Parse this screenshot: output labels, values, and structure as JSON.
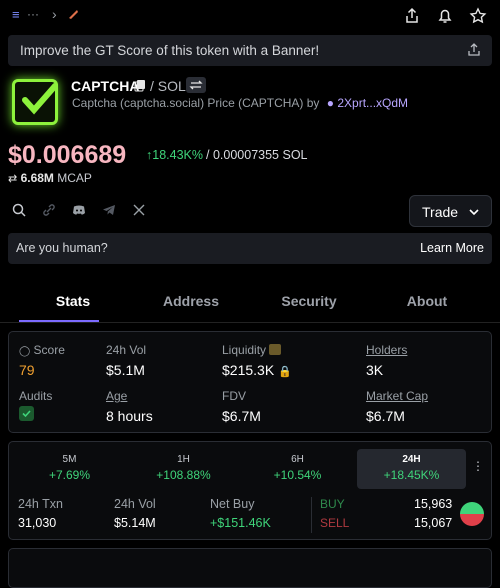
{
  "topbar": {
    "menu_glyph": "≡",
    "more_glyph": "···",
    "chevron_glyph": "›"
  },
  "banner": {
    "text": "Improve the GT Score of this token with a Banner!"
  },
  "token": {
    "name": "CAPTCHA",
    "pair": "/ SOL",
    "subtitle": "Captcha (captcha.social) Price (CAPTCHA) by",
    "creator": "2Xprt...xQdM"
  },
  "price": {
    "usd": "$0.006689",
    "change": "18.43K%",
    "sol_sep": "/",
    "sol": "0.00007355 SOL",
    "mcap_value": "6.68M",
    "mcap_label": "MCAP"
  },
  "trade_button": {
    "label": "Trade"
  },
  "human": {
    "question": "Are you human?",
    "learn_more": "Learn More"
  },
  "tabs": [
    "Stats",
    "Address",
    "Security",
    "About"
  ],
  "stats": {
    "score_label": "Score",
    "score_value": "79",
    "vol_label": "24h Vol",
    "vol_value": "$5.1M",
    "liq_label": "Liquidity",
    "liq_value": "$215.3K",
    "holders_label": "Holders",
    "holders_value": "3K",
    "audits_label": "Audits",
    "age_label": "Age",
    "age_value": "8 hours",
    "fdv_label": "FDV",
    "fdv_value": "$6.7M",
    "mcap_label": "Market Cap",
    "mcap_value": "$6.7M"
  },
  "periods": [
    {
      "label": "5M",
      "value": "+7.69%"
    },
    {
      "label": "1H",
      "value": "+108.88%"
    },
    {
      "label": "6H",
      "value": "+10.54%"
    },
    {
      "label": "24H",
      "value": "+18.45K%"
    }
  ],
  "txn": {
    "txn_label": "24h Txn",
    "txn_value": "31,030",
    "vol_label": "24h Vol",
    "vol_value": "$5.14M",
    "netbuy_label": "Net Buy",
    "netbuy_value": "+$151.46K",
    "buy_label": "BUY",
    "buy_value": "15,963",
    "sell_label": "SELL",
    "sell_value": "15,067"
  },
  "colors": {
    "accent": "#7c6bff",
    "positive": "#3fd47a",
    "negative": "#e0404a",
    "price": "#f7b6c0",
    "score": "#f0a030"
  }
}
